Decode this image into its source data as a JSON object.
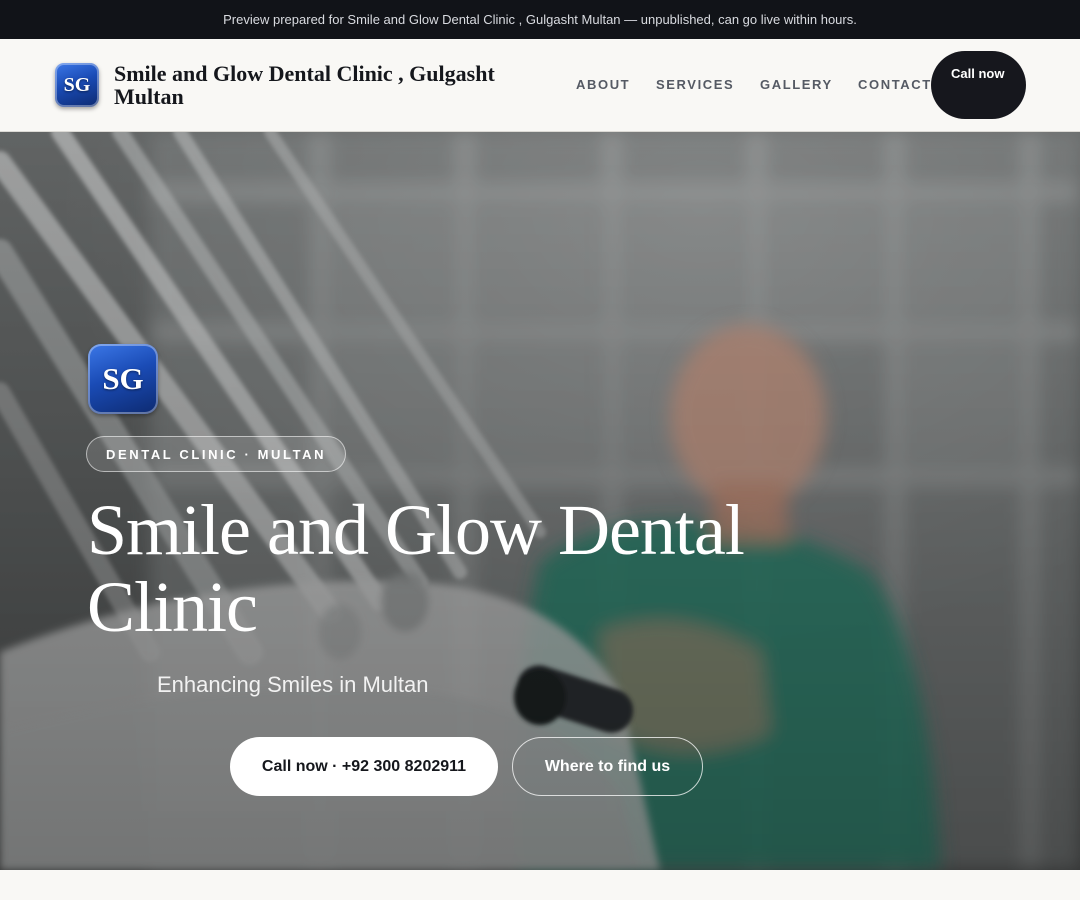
{
  "preview_banner": "Preview prepared for Smile and Glow Dental Clinic , Gulgasht Multan — unpublished, can go live within hours.",
  "header": {
    "logo_initials": "SG",
    "brand_name": "Smile and Glow Dental Clinic , Gulgasht Multan",
    "nav": [
      "ABOUT",
      "SERVICES",
      "GALLERY",
      "CONTACT"
    ],
    "call_button": "Call now"
  },
  "hero": {
    "logo_initials": "SG",
    "tag": "DENTAL CLINIC · MULTAN",
    "title": "Smile and Glow Dental Clinic",
    "subtitle": "Enhancing Smiles in Multan",
    "primary_button": "Call now · +92 300 8202911",
    "secondary_button": "Where to find us"
  },
  "colors": {
    "top_bar": "#111318",
    "header_bg": "#f9f8f5",
    "brand_text": "#15171c",
    "nav_text": "#555a64",
    "dark_button": "#16171d",
    "logo_blue": "#1a4bb5",
    "scrub_green": "#2f7f6c"
  }
}
